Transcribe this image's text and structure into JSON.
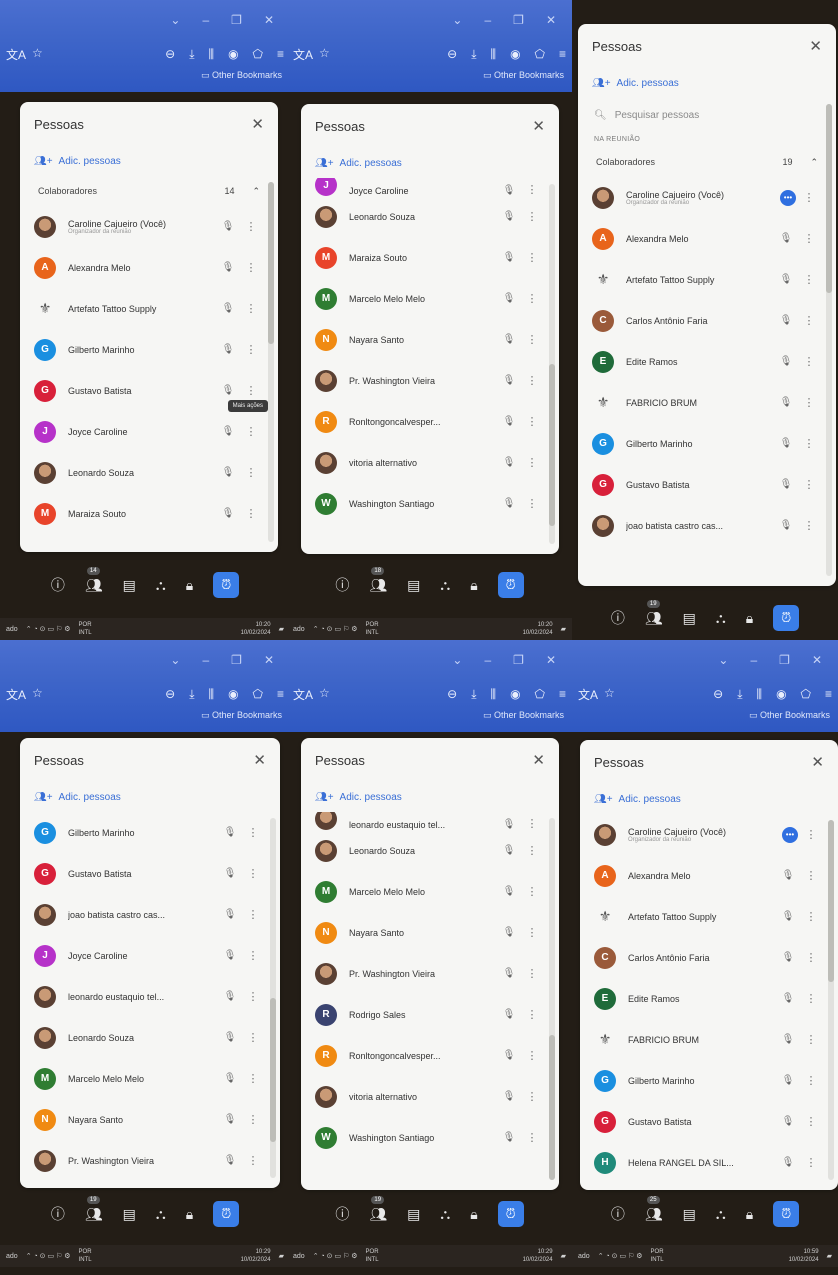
{
  "shared": {
    "panel_title": "Pessoas",
    "add_people": "Adic. pessoas",
    "search_placeholder": "Pesquisar pessoas",
    "in_meeting": "NA REUNIÃO",
    "collaborators": "Colaboradores",
    "organizer": "Organizador da reunião",
    "bookmarks": "Other Bookmarks",
    "more_actions_tooltip": "Mais ações",
    "lang": "POR",
    "lang2": "INTL",
    "taskbar_left": "ado"
  },
  "colors": {
    "chrome_blue": "#3f66c9",
    "accent_blue": "#3a6fd6",
    "active_mic": "#2f6fe0",
    "activities": "#3a7ee8"
  },
  "panels": [
    {
      "count": "14",
      "participants_badge": "14",
      "time": "10:20",
      "date": "10/02/2024",
      "show_collab_header": true,
      "people": [
        {
          "name": "Caroline Cajueiro (Você)",
          "sub": true,
          "avatar": "photo",
          "color": "#6b4a3a"
        },
        {
          "name": "Alexandra Melo",
          "initial": "A",
          "color": "#e8641b"
        },
        {
          "name": "Artefato Tattoo Supply",
          "avatar": "logo"
        },
        {
          "name": "Gilberto Marinho",
          "initial": "G",
          "color": "#1a8fe0"
        },
        {
          "name": "Gustavo Batista",
          "initial": "G",
          "color": "#d8203a",
          "tooltip": true
        },
        {
          "name": "Joyce Caroline",
          "initial": "J",
          "color": "#b632c9"
        },
        {
          "name": "Leonardo Souza",
          "avatar": "photo"
        },
        {
          "name": "Maraiza Souto",
          "initial": "M",
          "color": "#e8442a"
        }
      ]
    },
    {
      "participants_badge": "18",
      "time": "10:20",
      "date": "10/02/2024",
      "show_collab_header": false,
      "people": [
        {
          "name": "Joyce Caroline",
          "initial": "J",
          "color": "#b632c9",
          "partial": true
        },
        {
          "name": "Leonardo Souza",
          "avatar": "photo"
        },
        {
          "name": "Maraiza Souto",
          "initial": "M",
          "color": "#e8442a"
        },
        {
          "name": "Marcelo Melo Melo",
          "initial": "M",
          "color": "#2f7d32"
        },
        {
          "name": "Nayara Santo",
          "initial": "N",
          "color": "#f08a12"
        },
        {
          "name": "Pr. Washington Vieira",
          "avatar": "photo"
        },
        {
          "name": "Ronltongoncalvesper...",
          "initial": "R",
          "color": "#f08a12"
        },
        {
          "name": "vitoria alternativo",
          "avatar": "photo"
        },
        {
          "name": "Washington Santiago",
          "initial": "W",
          "color": "#2f7d32"
        }
      ]
    },
    {
      "count": "19",
      "participants_badge": "19",
      "show_search": true,
      "show_collab_header": true,
      "people": [
        {
          "name": "Caroline Cajueiro (Você)",
          "sub": true,
          "avatar": "photo",
          "active": true
        },
        {
          "name": "Alexandra Melo",
          "initial": "A",
          "color": "#e8641b"
        },
        {
          "name": "Artefato Tattoo Supply",
          "avatar": "logo"
        },
        {
          "name": "Carlos Antônio Faria",
          "initial": "C",
          "color": "#9a5a3a"
        },
        {
          "name": "Edite Ramos",
          "initial": "E",
          "color": "#1f6b3a"
        },
        {
          "name": "FABRICIO BRUM",
          "avatar": "logo"
        },
        {
          "name": "Gilberto Marinho",
          "initial": "G",
          "color": "#1a8fe0"
        },
        {
          "name": "Gustavo Batista",
          "initial": "G",
          "color": "#d8203a"
        },
        {
          "name": "joao batista castro cas...",
          "avatar": "photo"
        }
      ]
    },
    {
      "participants_badge": "19",
      "time": "10:29",
      "date": "10/02/2024",
      "show_collab_header": false,
      "people": [
        {
          "name": "Gilberto Marinho",
          "initial": "G",
          "color": "#1a8fe0"
        },
        {
          "name": "Gustavo Batista",
          "initial": "G",
          "color": "#d8203a"
        },
        {
          "name": "joao batista castro cas...",
          "avatar": "photo"
        },
        {
          "name": "Joyce Caroline",
          "initial": "J",
          "color": "#b632c9"
        },
        {
          "name": "leonardo eustaquio tel...",
          "avatar": "photo"
        },
        {
          "name": "Leonardo Souza",
          "avatar": "photo"
        },
        {
          "name": "Marcelo Melo Melo",
          "initial": "M",
          "color": "#2f7d32"
        },
        {
          "name": "Nayara Santo",
          "initial": "N",
          "color": "#f08a12"
        },
        {
          "name": "Pr. Washington Vieira",
          "avatar": "photo"
        }
      ]
    },
    {
      "participants_badge": "19",
      "time": "10:29",
      "date": "10/02/2024",
      "show_collab_header": false,
      "people": [
        {
          "name": "leonardo eustaquio tel...",
          "avatar": "photo",
          "partial": true
        },
        {
          "name": "Leonardo Souza",
          "avatar": "photo"
        },
        {
          "name": "Marcelo Melo Melo",
          "initial": "M",
          "color": "#2f7d32"
        },
        {
          "name": "Nayara Santo",
          "initial": "N",
          "color": "#f08a12"
        },
        {
          "name": "Pr. Washington Vieira",
          "avatar": "photo"
        },
        {
          "name": "Rodrigo Sales",
          "initial": "R",
          "color": "#3a4370"
        },
        {
          "name": "Ronltongoncalvesper...",
          "initial": "R",
          "color": "#f08a12"
        },
        {
          "name": "vitoria alternativo",
          "avatar": "photo"
        },
        {
          "name": "Washington Santiago",
          "initial": "W",
          "color": "#2f7d32"
        }
      ]
    },
    {
      "participants_badge": "25",
      "time": "10:59",
      "date": "10/02/2024",
      "show_collab_header": false,
      "people": [
        {
          "name": "Caroline Cajueiro (Você)",
          "sub": true,
          "avatar": "photo",
          "active": true
        },
        {
          "name": "Alexandra Melo",
          "initial": "A",
          "color": "#e8641b"
        },
        {
          "name": "Artefato Tattoo Supply",
          "avatar": "logo"
        },
        {
          "name": "Carlos Antônio Faria",
          "initial": "C",
          "color": "#9a5a3a"
        },
        {
          "name": "Edite Ramos",
          "initial": "E",
          "color": "#1f6b3a"
        },
        {
          "name": "FABRICIO BRUM",
          "avatar": "logo"
        },
        {
          "name": "Gilberto Marinho",
          "initial": "G",
          "color": "#1a8fe0"
        },
        {
          "name": "Gustavo Batista",
          "initial": "G",
          "color": "#d8203a"
        },
        {
          "name": "Helena RANGEL DA SIL...",
          "initial": "H",
          "color": "#1f8a7a"
        }
      ]
    }
  ]
}
